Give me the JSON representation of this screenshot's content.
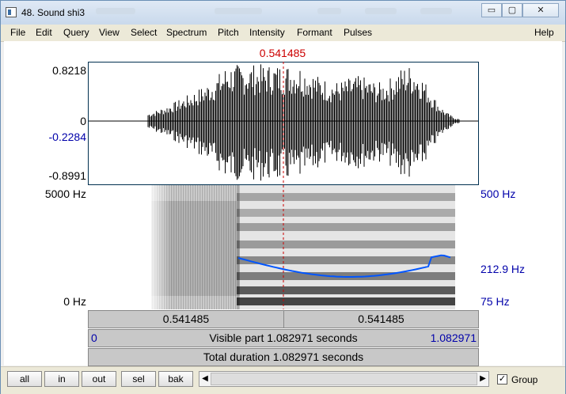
{
  "window": {
    "title": "48. Sound shi3",
    "controls": {
      "minimize": "▭",
      "maximize": "▢",
      "close": "✕"
    }
  },
  "menu": [
    "File",
    "Edit",
    "Query",
    "View",
    "Select",
    "Spectrum",
    "Pitch",
    "Intensity",
    "Formant",
    "Pulses"
  ],
  "menu_help": "Help",
  "cursor": {
    "time": "0.541485"
  },
  "waveform": {
    "ymax": "0.8218",
    "zero": "0",
    "cursor_value": "-0.2284",
    "ymin": "-0.8991"
  },
  "spectrogram": {
    "fmax": "5000 Hz",
    "fmin": "0 Hz",
    "pitch_top": "500 Hz",
    "pitch_current": "212.9 Hz",
    "pitch_bottom": "75 Hz"
  },
  "time_row": {
    "left": "0.541485",
    "right": "0.541485"
  },
  "visible_row": {
    "start": "0",
    "label": "Visible part 1.082971 seconds",
    "end": "1.082971"
  },
  "total_row": {
    "label": "Total duration 1.082971 seconds"
  },
  "buttons": {
    "all": "all",
    "in": "in",
    "out": "out",
    "sel": "sel",
    "bak": "bak"
  },
  "group": {
    "label": "Group",
    "checked": true,
    "check_mark": "✓"
  },
  "scroll": {
    "left": "◀",
    "right": "▶"
  },
  "colors": {
    "cursor": "#cc0000",
    "pitch": "#0055ff",
    "axis_blue": "#0000aa"
  }
}
